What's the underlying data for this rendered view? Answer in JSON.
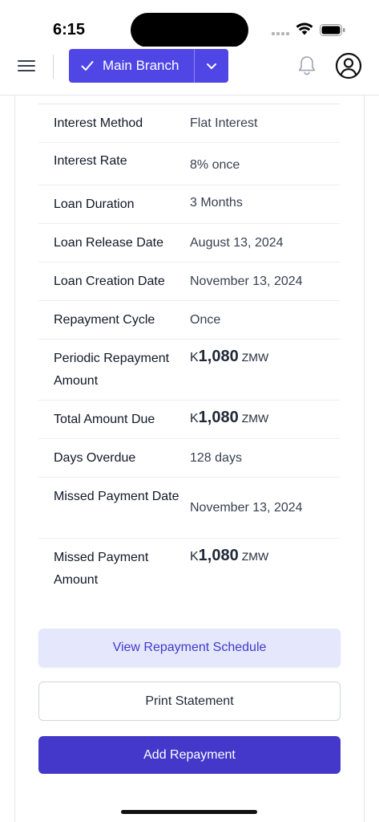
{
  "status_bar": {
    "time": "6:15",
    "icons": [
      "cellular-signal-icon",
      "wifi-icon",
      "battery-icon"
    ]
  },
  "header": {
    "menu_icon": "hamburger-menu-icon",
    "branch_label": "Main Branch",
    "branch_icon": "check-icon",
    "dropdown_icon": "chevron-down-icon",
    "notification_icon": "bell-icon",
    "profile_icon": "user-circle-icon",
    "accent_color": "#4f46e5"
  },
  "details": [
    {
      "label": "Interest Method",
      "value": "Flat Interest"
    },
    {
      "label": "Interest Rate",
      "value": "8% once"
    },
    {
      "label": "Loan Duration",
      "value": "3 Months"
    },
    {
      "label": "Loan Release Date",
      "value": "August 13, 2024"
    },
    {
      "label": "Loan Creation Date",
      "value": "November 13, 2024"
    },
    {
      "label": "Repayment Cycle",
      "value": "Once"
    },
    {
      "label": "Periodic Repayment Amount",
      "currency_symbol": "K",
      "amount": "1,080",
      "unit": "ZMW"
    },
    {
      "label": "Total Amount Due",
      "currency_symbol": "K",
      "amount": "1,080",
      "unit": "ZMW"
    },
    {
      "label": "Days Overdue",
      "value": "128 days"
    },
    {
      "label": "Missed Payment Date",
      "value": "November 13, 2024"
    },
    {
      "label": "Missed Payment Amount",
      "currency_symbol": "K",
      "amount": "1,080",
      "unit": "ZMW"
    }
  ],
  "actions": {
    "view_schedule": "View Repayment Schedule",
    "print_statement": "Print Statement",
    "add_repayment": "Add Repayment"
  },
  "colors": {
    "primary": "#4338ca",
    "secondary_bg": "#e5e8fd"
  }
}
